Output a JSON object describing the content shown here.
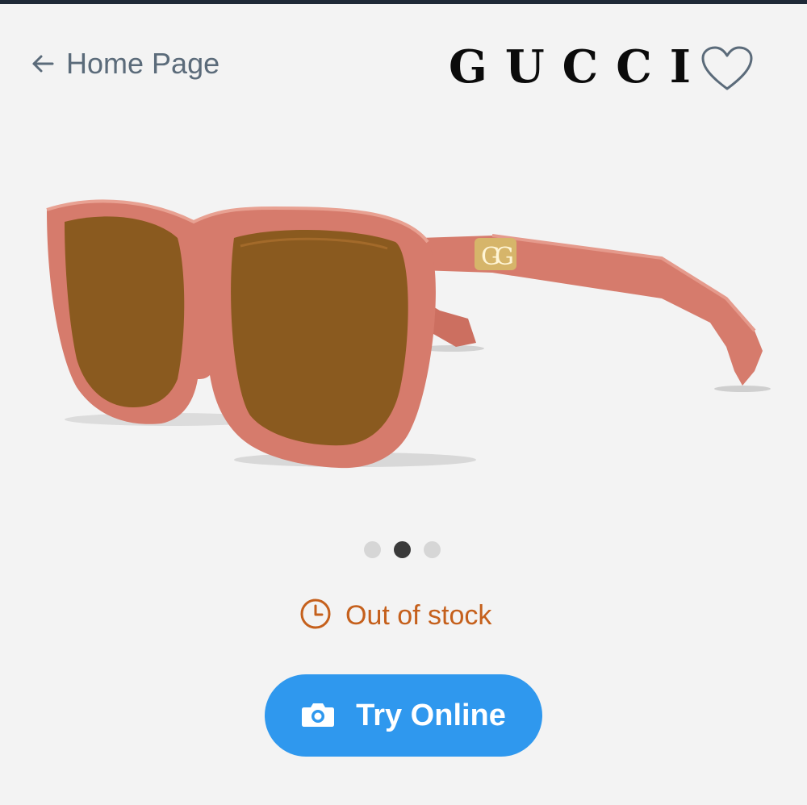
{
  "header": {
    "back_label": "Home Page",
    "brand": "GUCCI"
  },
  "icons": {
    "back": "arrow-left-icon",
    "favorite": "heart-icon",
    "stock": "clock-icon",
    "camera": "camera-icon"
  },
  "product": {
    "image_alt": "Gucci sunglasses with pink frame and brown lenses",
    "frame_color": "#d67b6c",
    "lens_color": "#8a5a1f"
  },
  "carousel": {
    "total": 3,
    "active_index": 1
  },
  "status": {
    "label": "Out of stock",
    "color": "#c5601c"
  },
  "actions": {
    "try_online_label": "Try Online",
    "button_color": "#2f98ee"
  }
}
